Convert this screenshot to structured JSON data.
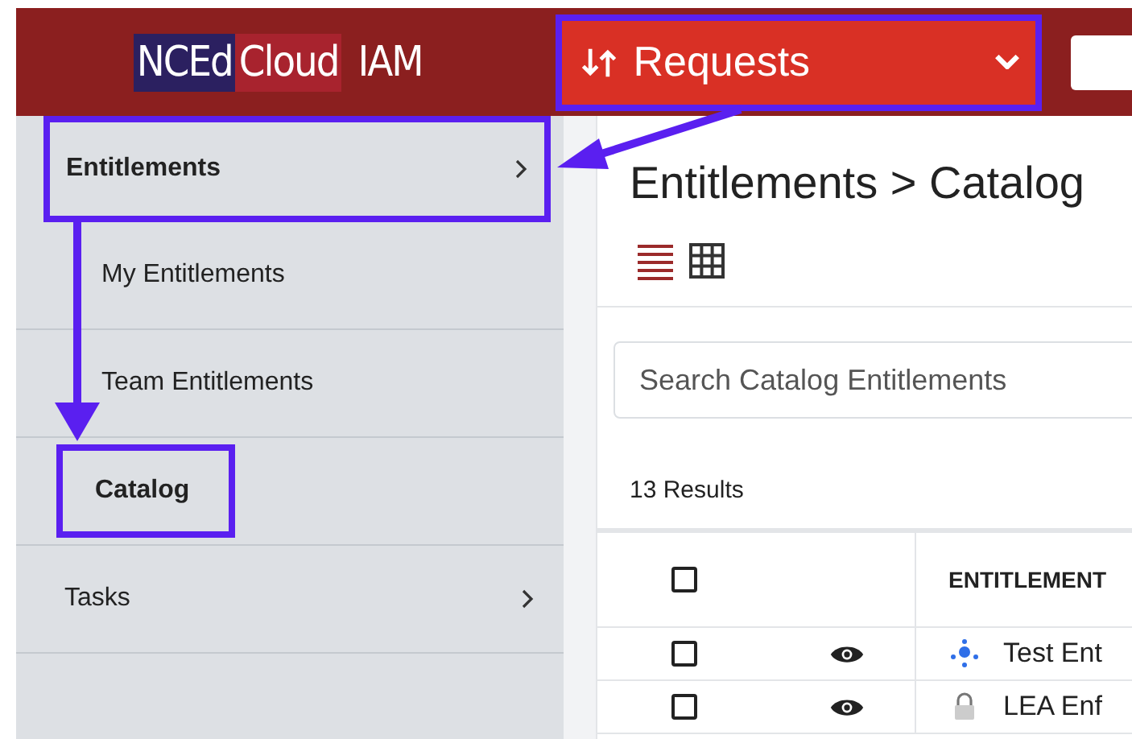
{
  "header": {
    "logo": {
      "part_1": "NCEd",
      "part_2": "Cloud",
      "part_3": "IAM"
    },
    "menu": {
      "label": "Requests",
      "highlighted": true
    }
  },
  "sidebar": {
    "items": [
      {
        "label": "Entitlements",
        "expanded": true,
        "highlighted": true,
        "children": [
          {
            "label": "My Entitlements",
            "selected": false,
            "highlighted": false
          },
          {
            "label": "Team Entitlements",
            "selected": false,
            "highlighted": false
          },
          {
            "label": "Catalog",
            "selected": true,
            "highlighted": true
          }
        ]
      },
      {
        "label": "Tasks",
        "expanded": false,
        "highlighted": false
      }
    ]
  },
  "main": {
    "breadcrumb": "Entitlements > Catalog",
    "views": [
      {
        "kind": "list",
        "selected": true
      },
      {
        "kind": "grid",
        "selected": false
      }
    ],
    "search": {
      "placeholder": "Search Catalog Entitlements"
    },
    "results": "13 Results",
    "table": {
      "all_checked": false,
      "columns": [
        "ENTITLEMENT"
      ],
      "rows": [
        {
          "checked": false,
          "kind": "network",
          "name": "Test Ent"
        },
        {
          "checked": false,
          "kind": "lock",
          "name": "LEA Enf"
        }
      ]
    }
  }
}
